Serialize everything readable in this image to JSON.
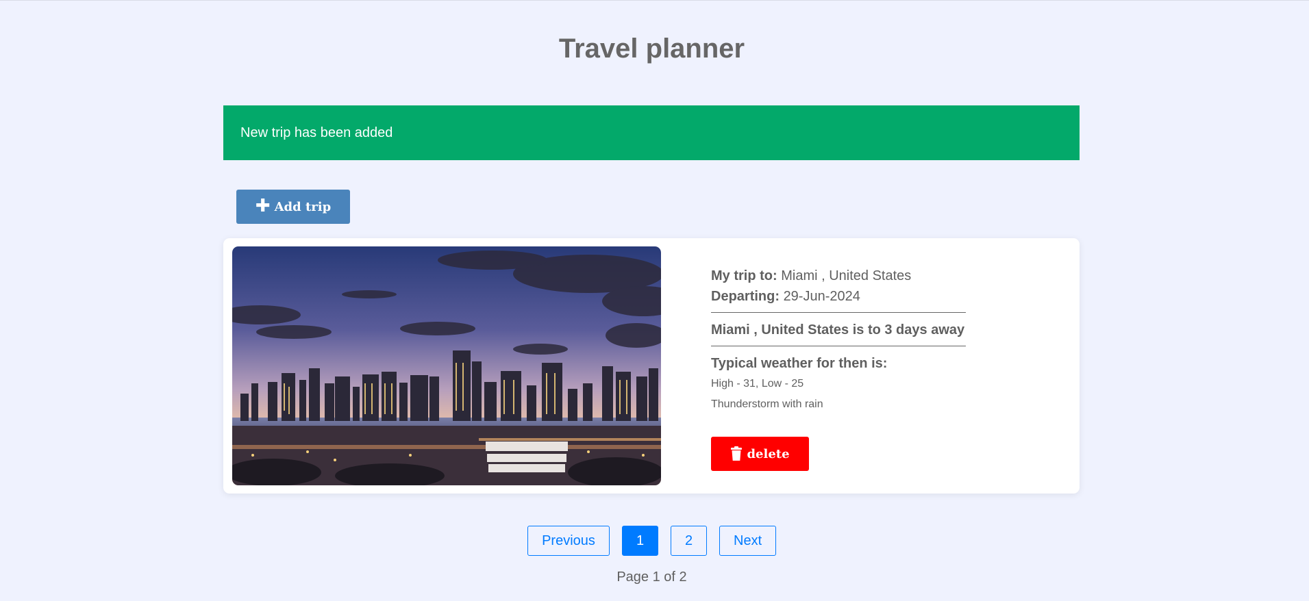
{
  "header": {
    "title": "Travel planner"
  },
  "alert": {
    "message": "New trip has been added",
    "color": "#03a96a"
  },
  "toolbar": {
    "add_trip_label": "Add trip",
    "add_trip_icon": "plus-icon"
  },
  "trip": {
    "image_icon": "city-skyline-photo",
    "destination_label": "My trip to:",
    "destination_value": "Miami , United States",
    "departing_label": "Departing:",
    "departing_value": "29-Jun-2024",
    "days_away": "Miami , United States is to 3 days away",
    "weather_title": "Typical weather for then is:",
    "temperature": "High - 31, Low - 25",
    "conditions": "Thunderstorm with rain",
    "delete_label": "delete",
    "delete_icon": "trash-icon",
    "delete_color": "#ff0000"
  },
  "pagination": {
    "previous_label": "Previous",
    "pages": [
      "1",
      "2"
    ],
    "current_page": "1",
    "next_label": "Next",
    "indicator": "Page 1 of 2",
    "accent": "#007bff"
  }
}
